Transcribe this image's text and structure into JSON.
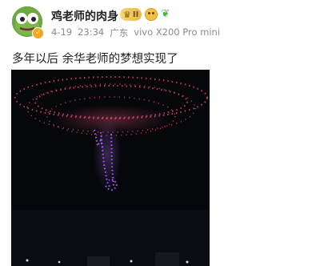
{
  "post": {
    "author": {
      "name": "鸡老师的肉身",
      "avatar_icon": "frog-avatar-icon",
      "verified_icon": "verified-badge-icon"
    },
    "badges": {
      "vip_level": "II",
      "vip_icon": "crown-icon",
      "fan_icon": "smiley-face-icon",
      "extra_icon": "sprout-icon"
    },
    "meta": {
      "date": "4-19",
      "time": "23:34",
      "location": "广东",
      "device": "vivo X200 Pro mini"
    },
    "text": "多年以后 余华老师的梦想实现了",
    "media": {
      "type": "image",
      "subject_icon": "drone-light-show-icon"
    }
  },
  "colors": {
    "text_primary": "#222222",
    "text_secondary": "#8a8a8a",
    "drone_red": "#e0456a",
    "drone_purple": "#b45cff",
    "avatar_green": "#6fa843"
  }
}
